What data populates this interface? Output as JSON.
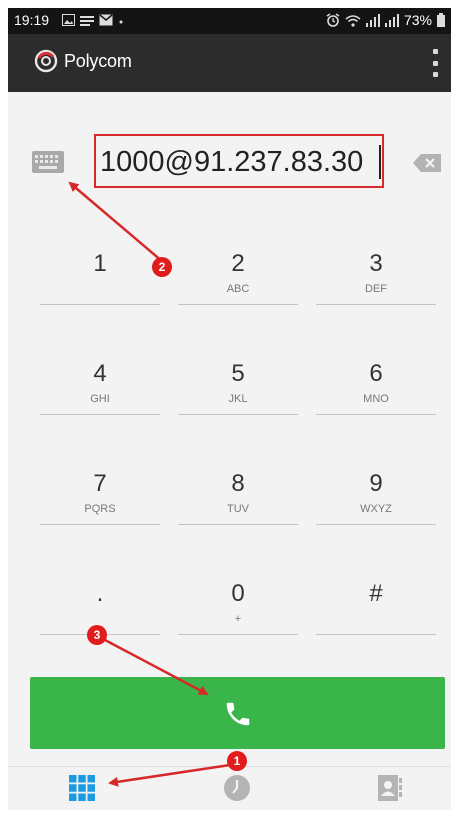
{
  "status_bar": {
    "time": "19:19",
    "battery": "73%"
  },
  "app_bar": {
    "brand": "Polycom"
  },
  "dialer": {
    "input_value": "1000@91.237.83.30",
    "keys": [
      {
        "digit": "1",
        "letters": ""
      },
      {
        "digit": "2",
        "letters": "ABC"
      },
      {
        "digit": "3",
        "letters": "DEF"
      },
      {
        "digit": "4",
        "letters": "GHI"
      },
      {
        "digit": "5",
        "letters": "JKL"
      },
      {
        "digit": "6",
        "letters": "MNO"
      },
      {
        "digit": "7",
        "letters": "PQRS"
      },
      {
        "digit": "8",
        "letters": "TUV"
      },
      {
        "digit": "9",
        "letters": "WXYZ"
      },
      {
        "digit": ".",
        "letters": ""
      },
      {
        "digit": "0",
        "letters": "+"
      },
      {
        "digit": "#",
        "letters": ""
      }
    ]
  },
  "annotations": {
    "badge_1": "1",
    "badge_2": "2",
    "badge_3": "3"
  },
  "colors": {
    "call_button": "#3ab54a",
    "app_bar": "#2c2c2c",
    "annotation_red": "#e01c1c",
    "nav_active": "#1e9be0"
  },
  "icons": {
    "keyboard": "keyboard-icon",
    "backspace": "backspace-icon",
    "call": "phone-icon",
    "dialpad": "dialpad-grid-icon",
    "history": "clock-icon",
    "contacts": "contacts-icon",
    "menu": "overflow-menu-icon"
  }
}
